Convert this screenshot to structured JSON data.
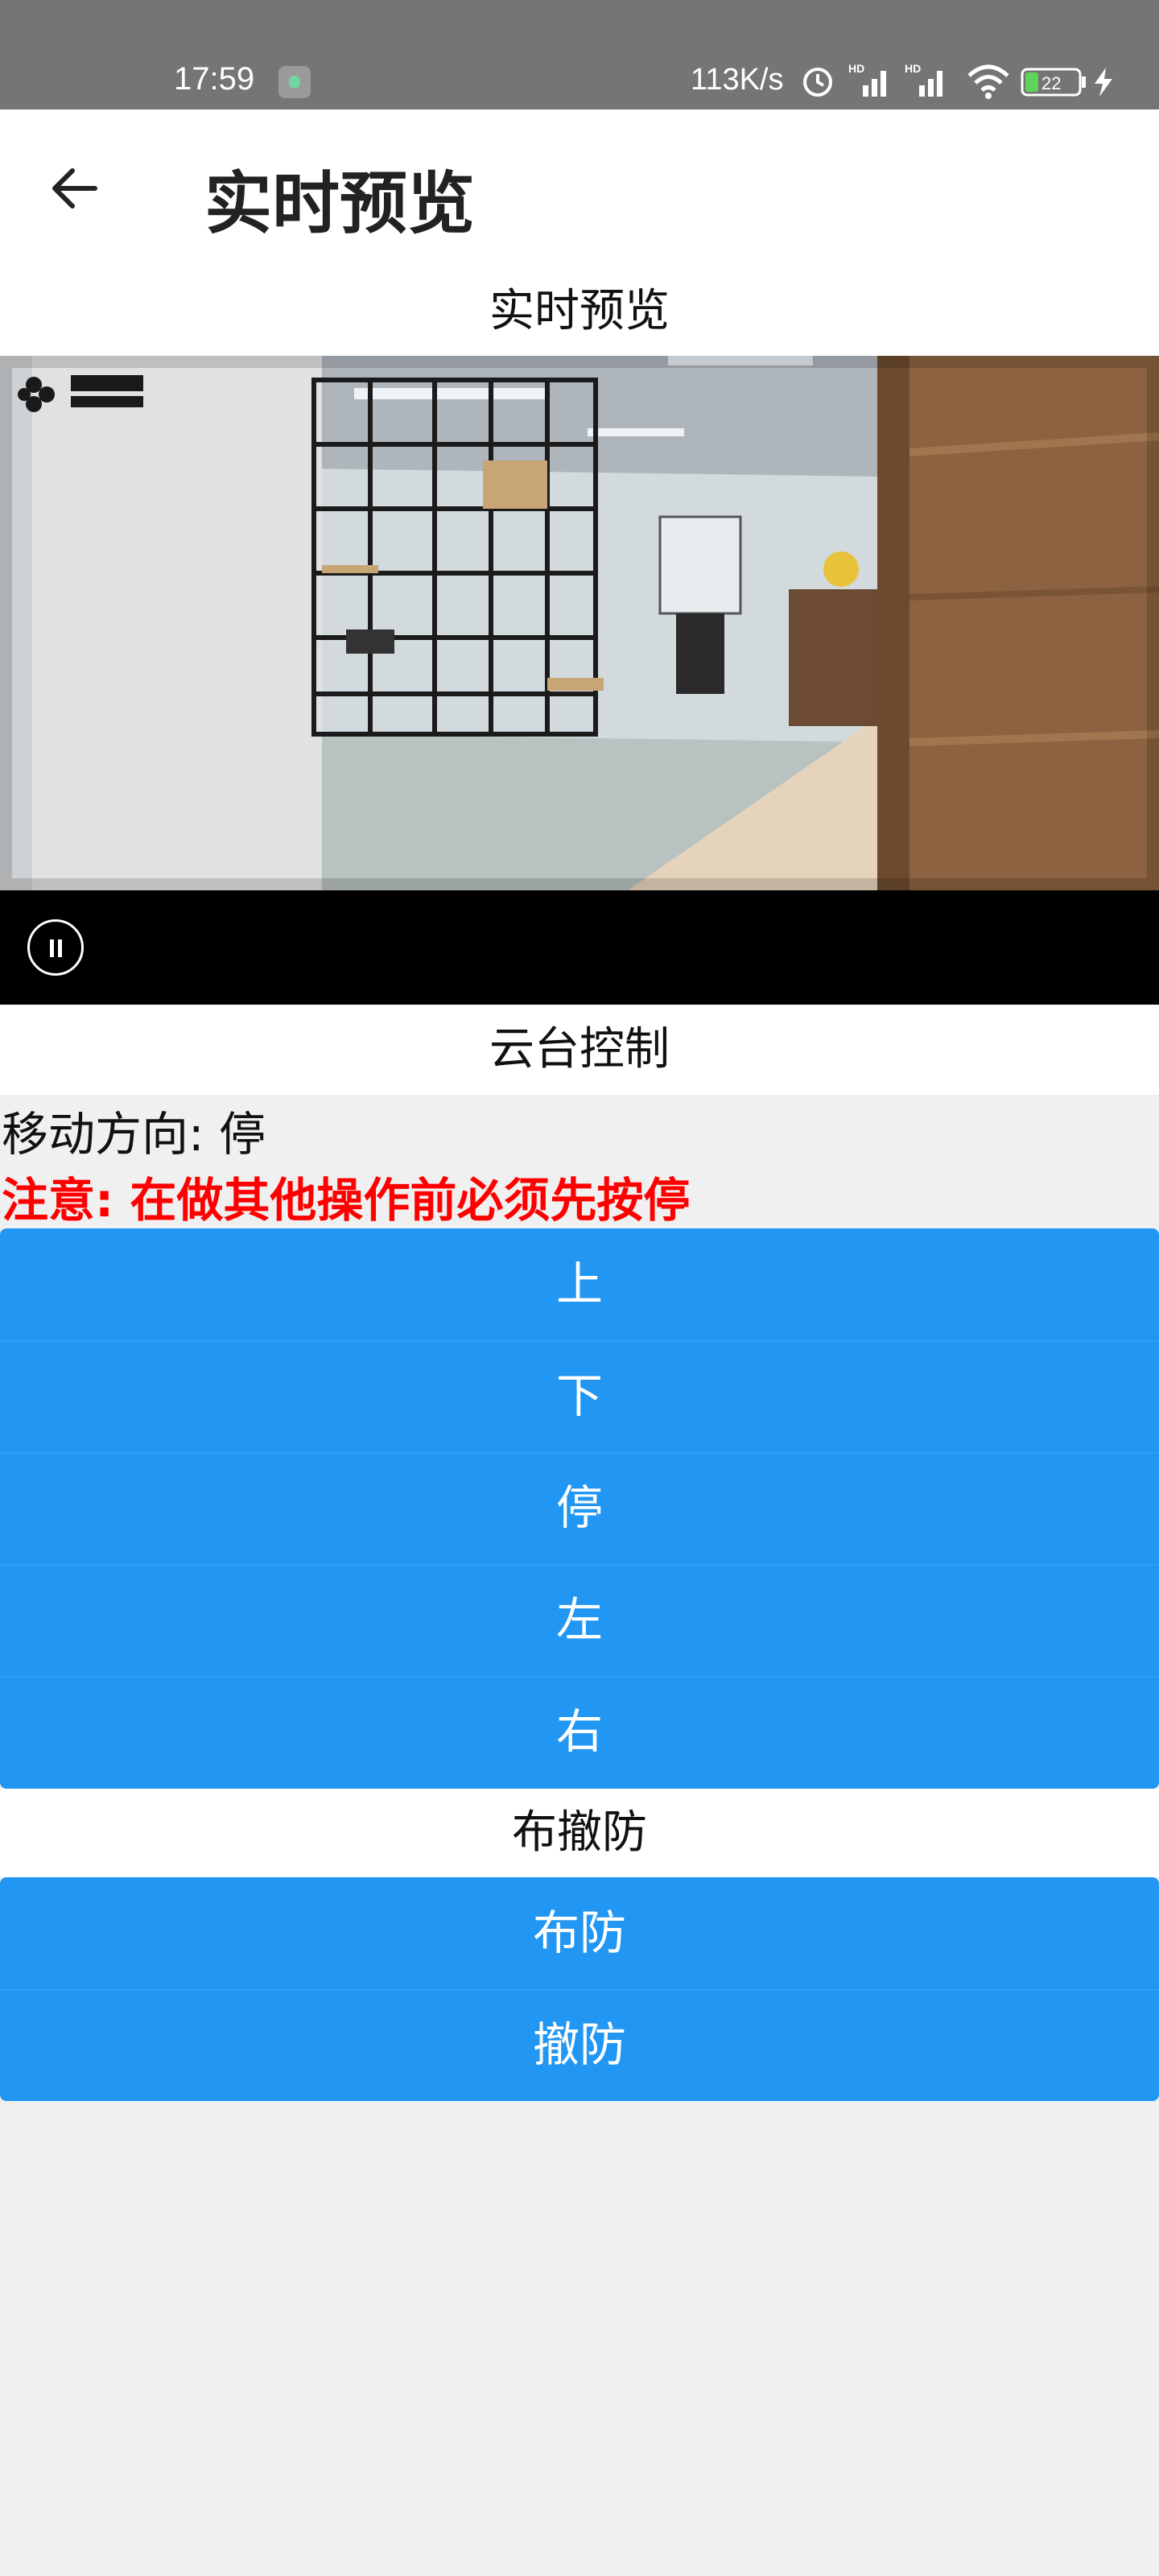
{
  "status_bar": {
    "time": "17:59",
    "network_speed": "113K/s",
    "battery": "22",
    "icons": [
      "alarm-icon",
      "hd-signal-icon",
      "hd-signal-icon",
      "wifi-icon",
      "battery-icon",
      "charging-icon"
    ]
  },
  "app_bar": {
    "title": "实时预览",
    "back_icon": "arrow-left-icon"
  },
  "preview_section": {
    "header": "实时预览",
    "watermark": "萤石云 ezviz"
  },
  "ptz_section": {
    "header": "云台控制",
    "direction_text": "移动方向: 停",
    "warning_text": "注意: 在做其他操作前必须先按停",
    "buttons": [
      {
        "label": "上"
      },
      {
        "label": "下"
      },
      {
        "label": "停"
      },
      {
        "label": "左"
      },
      {
        "label": "右"
      }
    ]
  },
  "arm_section": {
    "header": "布撤防",
    "buttons": [
      {
        "label": "布防"
      },
      {
        "label": "撤防"
      }
    ]
  },
  "colors": {
    "status_bar": "#757575",
    "accent_button": "#2196f3",
    "warning": "#ff0000",
    "background": "#f0f0f0"
  }
}
